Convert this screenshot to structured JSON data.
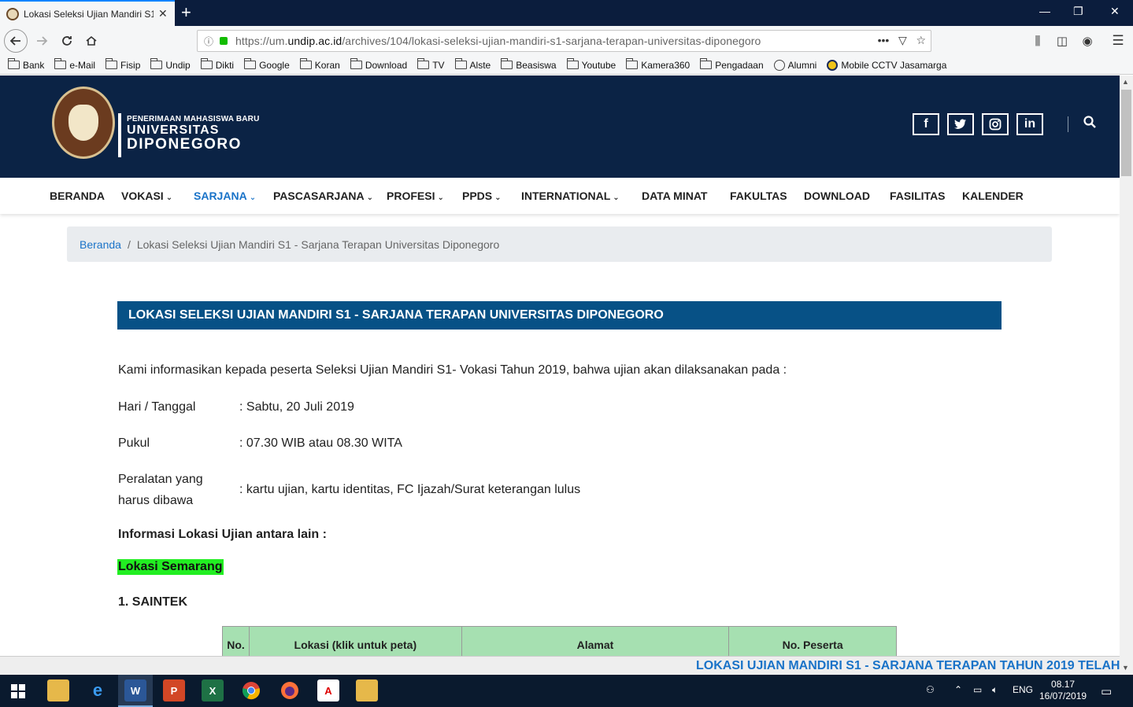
{
  "browser": {
    "tab_title": "Lokasi Seleksi Ujian Mandiri S1",
    "tab_close": "✕",
    "new_tab": "+",
    "window_controls": {
      "minimize": "—",
      "restore": "❐",
      "close": "✕"
    },
    "url_prefix": "https://um.",
    "url_domain": "undip.ac.id",
    "url_path": "/archives/104/lokasi-seleksi-ujian-mandiri-s1-sarjana-terapan-universitas-diponegoro",
    "url_actions": "•••",
    "bookmarks": [
      "Bank",
      "e-Mail",
      "Fisip",
      "Undip",
      "Dikti",
      "Google",
      "Koran",
      "Download",
      "TV",
      "Alste",
      "Beasiswa",
      "Youtube",
      "Kamera360",
      "Pengadaan",
      "Alumni",
      "Mobile CCTV Jasamarga"
    ]
  },
  "header": {
    "brand_small": "PENERIMAAN MAHASISWA BARU",
    "brand_line1": "UNIVERSITAS",
    "brand_line2": "DIPONEGORO",
    "social": {
      "facebook": "f",
      "twitter": "t",
      "instagram": "◎",
      "linkedin": "in"
    }
  },
  "nav": {
    "items": [
      {
        "label": "BERANDA",
        "caret": ""
      },
      {
        "label": "VOKASI",
        "caret": "⌄"
      },
      {
        "label": "SARJANA",
        "caret": "⌄"
      },
      {
        "label": "PASCASARJANA",
        "caret": "⌄"
      },
      {
        "label": "PROFESI",
        "caret": "⌄"
      },
      {
        "label": "PPDS",
        "caret": "⌄"
      },
      {
        "label": "INTERNATIONAL",
        "caret": "⌄"
      },
      {
        "label": "DATA MINAT",
        "caret": ""
      },
      {
        "label": "FAKULTAS",
        "caret": ""
      },
      {
        "label": "DOWNLOAD",
        "caret": ""
      },
      {
        "label": "FASILITAS",
        "caret": ""
      },
      {
        "label": "KALENDER",
        "caret": ""
      }
    ]
  },
  "breadcrumb": {
    "home": "Beranda",
    "separator": "/",
    "current": "Lokasi Seleksi Ujian Mandiri S1 - Sarjana Terapan Universitas Diponegoro"
  },
  "article": {
    "title": "LOKASI SELEKSI UJIAN MANDIRI S1 - SARJANA TERAPAN UNIVERSITAS DIPONEGORO",
    "intro": "Kami informasikan kepada peserta Seleksi Ujian Mandiri S1- Vokasi Tahun 2019, bahwa ujian akan dilaksanakan pada :",
    "details": [
      {
        "label": "Hari / Tanggal",
        "value": ": Sabtu, 20 Juli 2019"
      },
      {
        "label": "Pukul",
        "value": ": 07.30 WIB atau 08.30 WITA"
      },
      {
        "label1": "Peralatan yang",
        "label2": "harus dibawa",
        "value": ": kartu ujian, kartu identitas, FC Ijazah/Surat keterangan lulus"
      }
    ],
    "info_heading": "Informasi Lokasi Ujian antara lain :",
    "location_heading": "Lokasi Semarang",
    "section_heading": "1. SAINTEK",
    "table_headers": [
      "No.",
      "Lokasi (klik untuk peta)",
      "Alamat",
      "No. Peserta"
    ]
  },
  "marquee": "LOKASI UJIAN MANDIRI S1 - SARJANA TERAPAN TAHUN 2019 TELAH",
  "taskbar": {
    "language": "ENG",
    "time": "08.17",
    "date": "16/07/2019"
  },
  "colors": {
    "header_bg": "#0b2345",
    "title_bar": "#075186",
    "accent_link": "#1a73c8",
    "highlight": "#22ee22",
    "table_header": "#a6e0b1"
  }
}
